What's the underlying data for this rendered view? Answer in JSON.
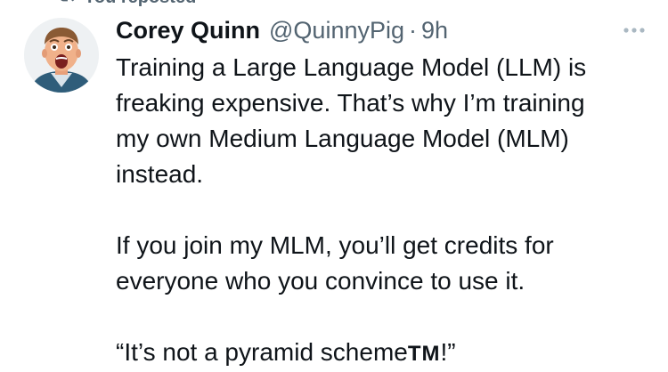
{
  "repost": {
    "label": "You reposted",
    "icon": "repost-icon"
  },
  "author": {
    "name": "Corey Quinn",
    "handle": "@QuinnyPig",
    "separator": "·",
    "time": "9h",
    "avatar_icon": "avatar-photo"
  },
  "more_icon": "more-icon",
  "tweet": {
    "para1_line1": "Training a Large Language Model (LLM) is",
    "para1_line2": "freaking expensive. That’s why I’m training",
    "para1_line3": "my own Medium Language Model (MLM)",
    "para1_line4": "instead.",
    "para2_line1": "If you join my MLM, you’ll get credits for",
    "para2_line2": "everyone who you convince to use it.",
    "para3_before": "“It’s not a pyramid scheme",
    "para3_tm": "TM",
    "para3_after": "!”"
  },
  "colors": {
    "text": "#0f1419",
    "secondary": "#536471",
    "background": "#ffffff"
  }
}
